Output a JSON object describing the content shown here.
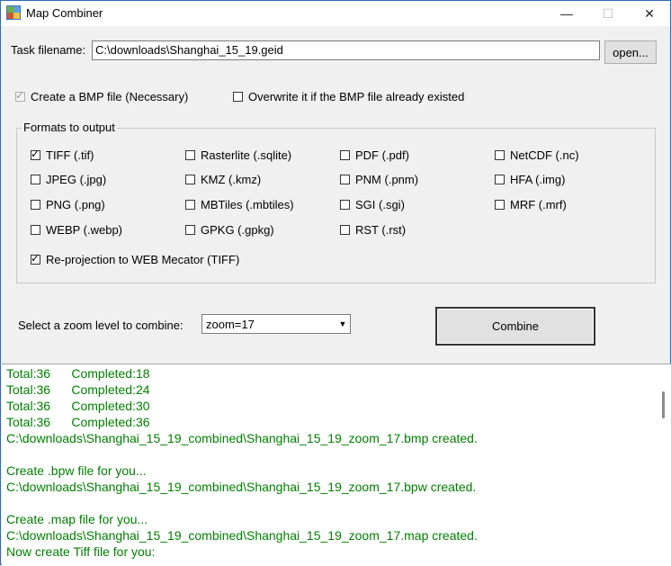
{
  "window": {
    "title": "Map Combiner",
    "minimize": "—",
    "maximize": "☐",
    "close": "✕"
  },
  "task": {
    "label": "Task filename:",
    "value": "C:\\downloads\\Shanghai_15_19.geid",
    "open_label": "open..."
  },
  "options": {
    "create_bmp": {
      "label": "Create a  BMP file (Necessary)",
      "checked": true
    },
    "overwrite": {
      "label": "Overwrite it if the BMP file already existed",
      "checked": false
    }
  },
  "formats": {
    "legend": "Formats to output",
    "items": [
      {
        "label": "TIFF (.tif)",
        "checked": true
      },
      {
        "label": "Rasterlite (.sqlite)",
        "checked": false
      },
      {
        "label": "PDF (.pdf)",
        "checked": false
      },
      {
        "label": "NetCDF (.nc)",
        "checked": false
      },
      {
        "label": "JPEG (.jpg)",
        "checked": false
      },
      {
        "label": "KMZ (.kmz)",
        "checked": false
      },
      {
        "label": "PNM (.pnm)",
        "checked": false
      },
      {
        "label": "HFA (.img)",
        "checked": false
      },
      {
        "label": "PNG (.png)",
        "checked": false
      },
      {
        "label": "MBTiles (.mbtiles)",
        "checked": false
      },
      {
        "label": "SGI (.sgi)",
        "checked": false
      },
      {
        "label": "MRF (.mrf)",
        "checked": false
      },
      {
        "label": "WEBP (.webp)",
        "checked": false
      },
      {
        "label": "GPKG (.gpkg)",
        "checked": false
      },
      {
        "label": "RST (.rst)",
        "checked": false
      }
    ],
    "reprojection": {
      "label": "Re-projection to WEB Mecator  (TIFF)",
      "checked": true
    }
  },
  "zoom": {
    "label": "Select a zoom level to combine:",
    "value": "zoom=17"
  },
  "combine_label": "Combine",
  "log": [
    "Total:36      Completed:18",
    "Total:36      Completed:24",
    "Total:36      Completed:30",
    "Total:36      Completed:36",
    "C:\\downloads\\Shanghai_15_19_combined\\Shanghai_15_19_zoom_17.bmp created.",
    "",
    "Create .bpw file for you...",
    "C:\\downloads\\Shanghai_15_19_combined\\Shanghai_15_19_zoom_17.bpw created.",
    "",
    "Create .map file for you...",
    "C:\\downloads\\Shanghai_15_19_combined\\Shanghai_15_19_zoom_17.map created.",
    "Now create Tiff file for you:"
  ]
}
